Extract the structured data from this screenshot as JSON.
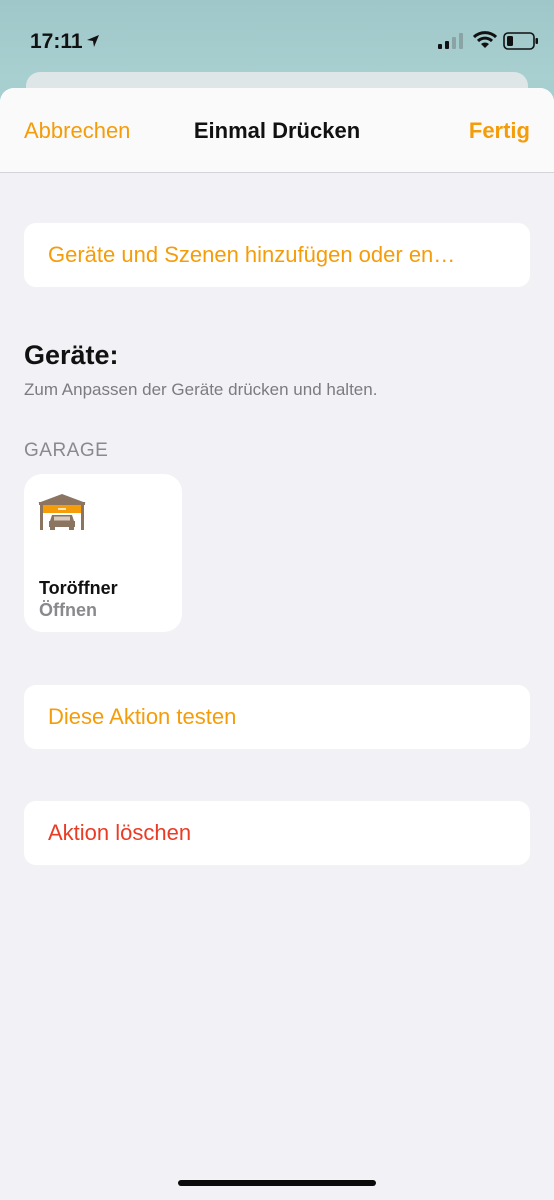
{
  "status_bar": {
    "time": "17:11"
  },
  "nav": {
    "cancel": "Abbrechen",
    "title": "Einmal Drücken",
    "done": "Fertig"
  },
  "add_devices": {
    "label": "Geräte und Szenen hinzufügen oder en…"
  },
  "devices": {
    "title": "Geräte:",
    "hint": "Zum Anpassen der Geräte drücken und halten.",
    "room": "GARAGE",
    "items": [
      {
        "name": "Toröffner",
        "state": "Öffnen",
        "icon": "garage-door-icon"
      }
    ]
  },
  "test_action": {
    "label": "Diese Aktion testen"
  },
  "delete_action": {
    "label": "Aktion löschen"
  },
  "colors": {
    "accent": "#f59c09",
    "destructive": "#ea3b25",
    "background": "#f1f1f6"
  }
}
